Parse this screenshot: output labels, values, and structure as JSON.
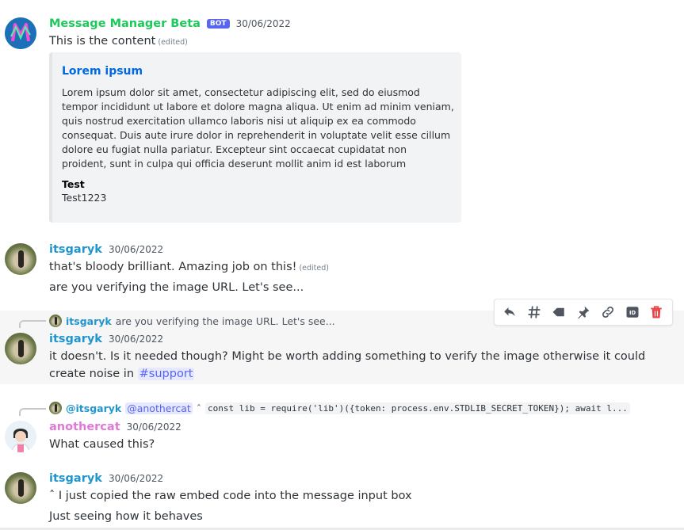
{
  "messages": [
    {
      "author": "Message Manager Beta",
      "bot_tag": "BOT",
      "timestamp": "30/06/2022",
      "content": "This is the content",
      "edited": "(edited)",
      "embed": {
        "title": "Lorem ipsum",
        "description": "Lorem ipsum dolor sit amet, consectetur adipiscing elit, sed do eiusmod tempor incididunt ut labore et dolore magna aliqua. Ut enim ad minim veniam, quis nostrud exercitation ullamco laboris nisi ut aliquip ex ea commodo consequat. Duis aute irure dolor in reprehenderit in voluptate velit esse cillum dolore eu fugiat nulla pariatur. Excepteur sint occaecat cupidatat non proident, sunt in culpa qui officia deserunt mollit anim id est laborum",
        "field_name": "Test",
        "field_value": "Test1223"
      }
    },
    {
      "author": "itsgaryk",
      "timestamp": "30/06/2022",
      "line1": "that's bloody brilliant. Amazing job on this!",
      "edited": "(edited)",
      "line2": "are you verifying the image URL. Let's see..."
    },
    {
      "reply_author": "itsgaryk",
      "reply_text": "are you verifying the image URL. Let's see...",
      "author": "itsgaryk",
      "timestamp": "30/06/2022",
      "content": "it doesn't. Is it needed though? Might be worth adding something to verify the image otherwise it could create noise in",
      "channel": "#support"
    },
    {
      "reply_author": "@itsgaryk",
      "reply_mention": "@anothercat",
      "reply_caret": "ˆ",
      "reply_code": "const lib = require('lib')({token: process.env.STDLIB_SECRET_TOKEN});  await l...",
      "author": "anothercat",
      "timestamp": "30/06/2022",
      "content": "What caused this?"
    },
    {
      "author": "itsgaryk",
      "timestamp": "30/06/2022",
      "line1": "ˆ I just copied the raw embed code into the message input box",
      "line2": "Just seeing how it behaves"
    }
  ],
  "toolbar": {
    "icons": [
      "reply-icon",
      "thread-icon",
      "tag-icon",
      "pin-icon",
      "link-icon",
      "id-icon",
      "delete-icon"
    ],
    "delete_color": "#ed4245",
    "icon_color": "#4f5660"
  },
  "colors": {
    "bot_name": "#1ec85b",
    "user_name": "#1f96cf",
    "anothercat_name": "#e078d6",
    "embed_title": "#0068e0",
    "bot_tag_bg": "#5865f2"
  }
}
